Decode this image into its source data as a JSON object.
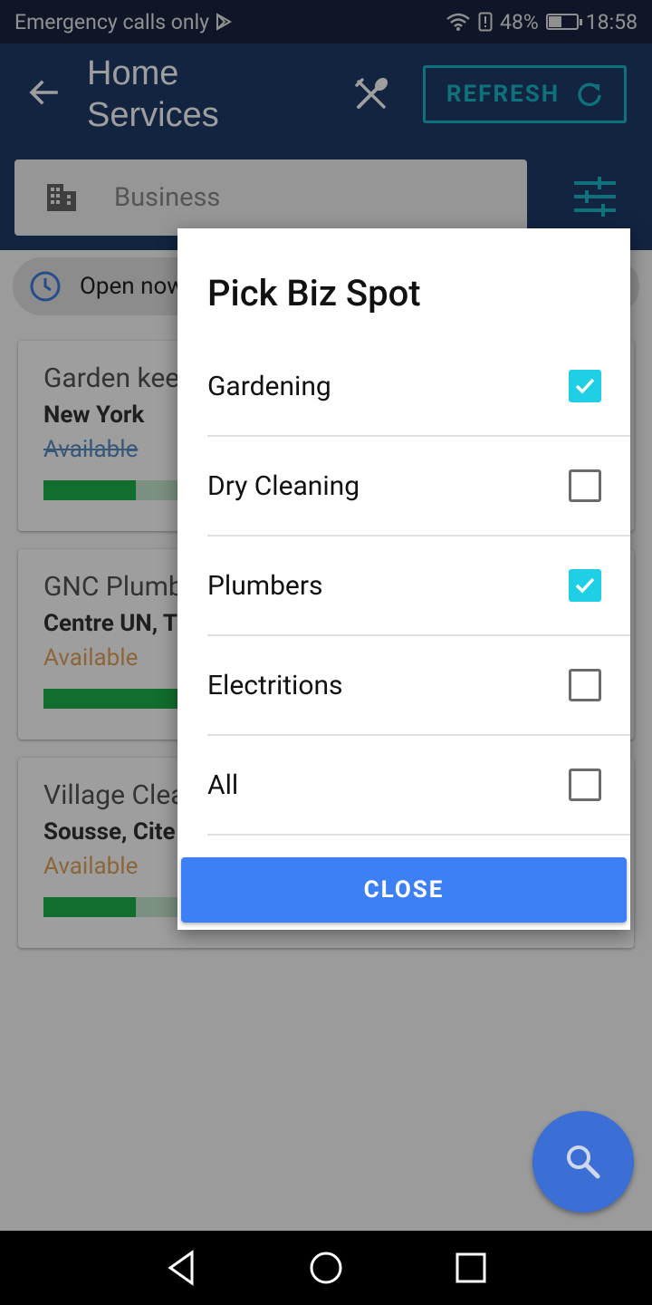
{
  "status_bar": {
    "carrier": "Emergency calls only",
    "battery": "48%",
    "time": "18:58"
  },
  "app_bar": {
    "title_line1": "Home",
    "title_line2": "Services",
    "refresh_label": "REFRESH"
  },
  "search": {
    "placeholder": "Business"
  },
  "chip": {
    "label": "Open now"
  },
  "cards": [
    {
      "title": "Garden keeping",
      "city": "New York",
      "status": "Available",
      "progress": 0.34
    },
    {
      "title": "GNC Plumbers",
      "city": "Centre UN, Tunis",
      "status": "Available",
      "progress": 0.5
    },
    {
      "title": "Village Cleaning",
      "city": "Sousse, Cite",
      "status": "Available",
      "progress": 0.34
    }
  ],
  "dialog": {
    "title": "Pick Biz Spot",
    "options": [
      {
        "label": "Gardening",
        "checked": true
      },
      {
        "label": "Dry Cleaning",
        "checked": false
      },
      {
        "label": "Plumbers",
        "checked": true
      },
      {
        "label": "Electritions",
        "checked": false
      },
      {
        "label": "All",
        "checked": false
      }
    ],
    "close_label": "CLOSE"
  },
  "colors": {
    "app_bar": "#1e3a68",
    "accent_teal": "#17b6c8",
    "checkbox_checked": "#1ecfe6",
    "close_button": "#3d80f5",
    "fab": "#3b6fd6",
    "progress": "#1db24a"
  }
}
